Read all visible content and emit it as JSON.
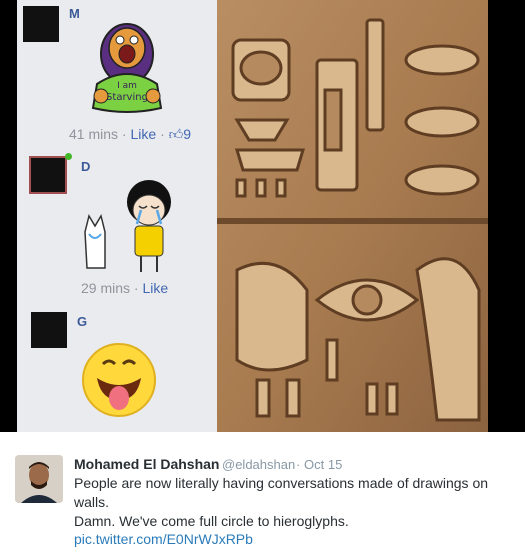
{
  "comments": [
    {
      "initial": "M",
      "time": "41 mins",
      "like_label": "Like",
      "like_count": "9",
      "sticker_text": "I am Starving"
    },
    {
      "initial": "D",
      "time": "29 mins",
      "like_label": "Like"
    },
    {
      "initial": "G"
    }
  ],
  "tweet": {
    "name": "Mohamed El Dahshan",
    "handle": "@eldahshan",
    "separator": "·",
    "date": "Oct 15",
    "line1": "People are now literally having conversations made of drawings on",
    "line2": "walls.",
    "line3": "Damn. We've come full circle to hieroglyphs.",
    "link": "pic.twitter.com/E0NrWJxRPb"
  },
  "colors": {
    "facebook_blue": "#3b5998",
    "stone": "#b0865c",
    "tweet_link": "#2b7bb9"
  }
}
